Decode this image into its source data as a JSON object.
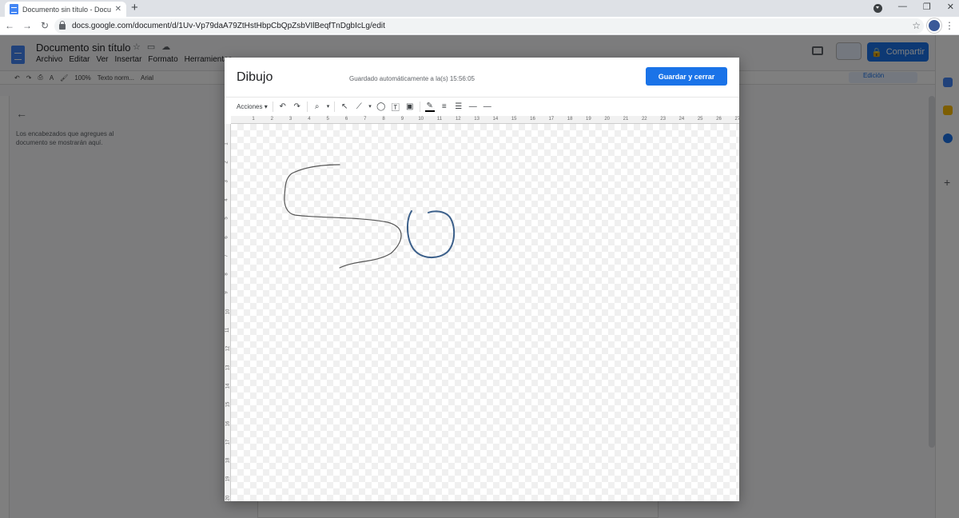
{
  "browser": {
    "tab_title": "Documento sin título - Documen",
    "tab_close": "✕",
    "new_tab": "+",
    "url": "docs.google.com/document/d/1Uv-Vp79daA79ZtHstHbpCbQpZsbVIlBeqfTnDgbIcLg/edit",
    "window_controls": [
      "—",
      "❐",
      "✕"
    ]
  },
  "docs": {
    "title": "Documento sin título",
    "menus": [
      "Archivo",
      "Editar",
      "Ver",
      "Insertar",
      "Formato",
      "Herramientas"
    ],
    "toolbar": {
      "zoom": "100%",
      "style": "Texto norm...",
      "font": "Arial"
    },
    "share_label": "Compartir",
    "edit_mode": "Edición",
    "outline_text": "Los encabezados que agregues al documento se mostrarán aquí."
  },
  "dialog": {
    "title": "Dibujo",
    "saved_status": "Guardado automáticamente a la(s) 15:56:05",
    "save_button": "Guardar y cerrar",
    "actions_menu": "Acciones"
  },
  "ruler": {
    "horizontal": [
      "1",
      "2",
      "3",
      "4",
      "5",
      "6",
      "7",
      "8",
      "9",
      "10",
      "11",
      "12",
      "13",
      "14",
      "15",
      "16",
      "17",
      "18",
      "19",
      "20",
      "21",
      "22",
      "23",
      "24",
      "25",
      "26",
      "27"
    ],
    "vertical": [
      "1",
      "2",
      "3",
      "4",
      "5",
      "6",
      "7",
      "8",
      "9",
      "10",
      "11",
      "12",
      "13",
      "14",
      "15",
      "16",
      "17",
      "18",
      "19",
      "20"
    ]
  },
  "colors": {
    "accent": "#1a73e8",
    "stroke": "#555555",
    "stroke_blue": "#3b5f8a"
  }
}
